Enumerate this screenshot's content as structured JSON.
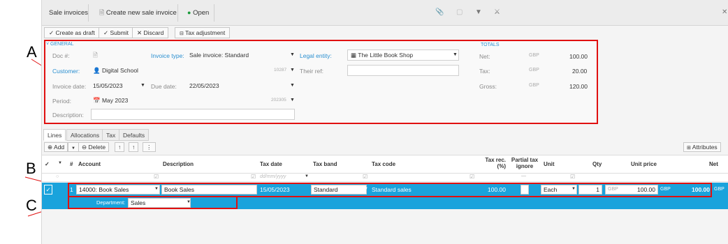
{
  "callouts": {
    "a": "A",
    "b": "B",
    "c": "C"
  },
  "topbar": {
    "crumb_list": "Sale invoices",
    "crumb_create": "Create new sale invoice",
    "status": "Open"
  },
  "actions": {
    "save_draft": "Create as draft",
    "submit": "Submit",
    "discard": "Discard",
    "tax_adjust": "Tax adjustment"
  },
  "general": {
    "section": "GENERAL",
    "doc_label": "Doc #:",
    "invoice_type_label": "Invoice type:",
    "invoice_type_value": "Sale invoice: Standard",
    "legal_entity_label": "Legal entity:",
    "legal_entity_value": "The Little Book Shop",
    "customer_label": "Customer:",
    "customer_value": "Digital School",
    "customer_code": "10287",
    "their_ref_label": "Their ref:",
    "invoice_date_label": "Invoice date:",
    "invoice_date_value": "15/05/2023",
    "due_date_label": "Due date:",
    "due_date_value": "22/05/2023",
    "period_label": "Period:",
    "period_value": "May 2023",
    "period_code": "202305",
    "description_label": "Description:"
  },
  "totals": {
    "section": "TOTALS",
    "net_label": "Net:",
    "tax_label": "Tax:",
    "gross_label": "Gross:",
    "currency": "GBP",
    "net_value": "100.00",
    "tax_value": "20.00",
    "gross_value": "120.00"
  },
  "tabs": [
    "Lines",
    "Allocations",
    "Tax",
    "Defaults"
  ],
  "grid_toolbar": {
    "add": "Add",
    "delete": "Delete",
    "attributes": "Attributes"
  },
  "columns": {
    "num": "#",
    "account": "Account",
    "description": "Description",
    "tax_date": "Tax date",
    "tax_band": "Tax band",
    "tax_code": "Tax code",
    "tax_rec_1": "Tax rec.",
    "tax_rec_2": "(%)",
    "partial_1": "Partial tax",
    "partial_2": "ignore",
    "unit": "Unit",
    "qty": "Qty",
    "unit_price": "Unit price",
    "net": "Net"
  },
  "filter_row": {
    "date_placeholder": "dd/mm/yyyy",
    "partial_filter": "—"
  },
  "line": {
    "num": "1",
    "account": "14000: Book Sales",
    "description": "Book Sales",
    "tax_date": "15/05/2023",
    "tax_band": "Standard",
    "tax_code": "Standard sales",
    "tax_rec": "100.00",
    "unit": "Each",
    "qty": "1",
    "price_currency": "GBP",
    "unit_price": "100.00",
    "net_currency": "GBP",
    "net": "100.00",
    "overflow_currency": "GBP"
  },
  "line_dimension": {
    "label": "Department:",
    "value": "Sales"
  }
}
